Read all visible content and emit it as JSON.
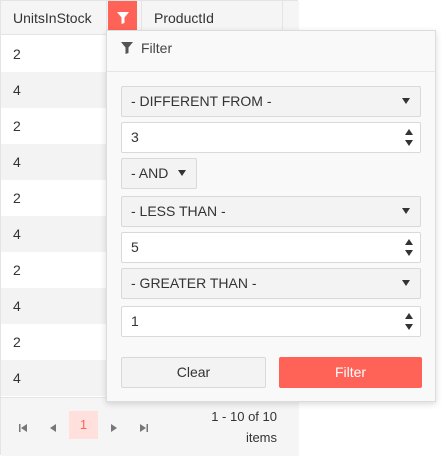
{
  "grid": {
    "columns": [
      "UnitsInStock",
      "ProductId"
    ],
    "rows": [
      "2",
      "4",
      "2",
      "4",
      "2",
      "4",
      "2",
      "4",
      "2",
      "4"
    ]
  },
  "pager": {
    "first_icon": "first-page-icon",
    "prev_icon": "previous-page-icon",
    "current_page": "1",
    "next_icon": "next-page-icon",
    "last_icon": "last-page-icon",
    "info_line1": "1 - 10 of 10",
    "info_line2": "items"
  },
  "filter": {
    "title": "Filter",
    "operator1": "- DIFFERENT FROM -",
    "value1": "3",
    "logic": "- AND",
    "operator2": "- LESS THAN -",
    "value2": "5",
    "operator3": "- GREATER THAN -",
    "value3": "1",
    "clear_label": "Clear",
    "apply_label": "Filter"
  },
  "colors": {
    "accent": "#ff6358",
    "accent_light": "#ffe0dd",
    "header_bg": "#f5f5f5"
  }
}
